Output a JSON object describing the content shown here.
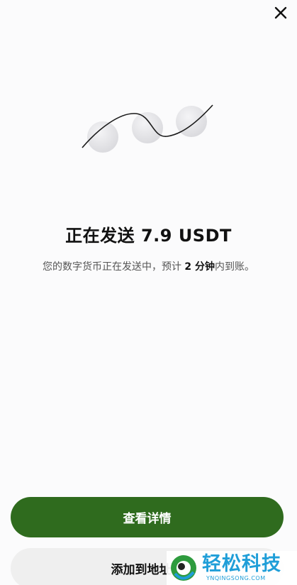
{
  "header": {
    "close_icon": "close-icon"
  },
  "illustration": {
    "icon": "coins-sending-icon"
  },
  "status": {
    "title": "正在发送 7.9 USDT",
    "subtitle_prefix": "您的数字货币正在发送中，预计",
    "subtitle_eta": "2 分钟",
    "subtitle_suffix": "内到账。"
  },
  "actions": {
    "view_details_label": "查看详情",
    "add_address_label": "添加到地址簿"
  },
  "watermark": {
    "brand": "轻松科技",
    "domain": "YNQINGSONG.COM"
  },
  "colors": {
    "primary": "#2f6b1e",
    "secondary_bg": "#efefef",
    "watermark": "#1f9ed8"
  }
}
